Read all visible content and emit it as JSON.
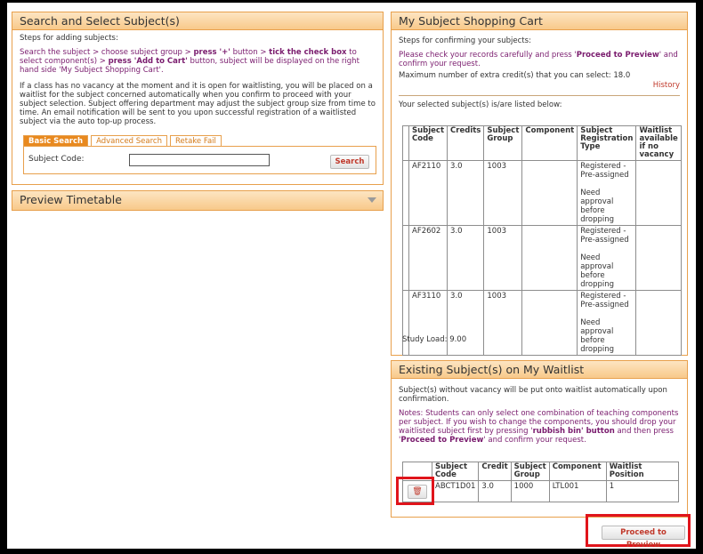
{
  "left_panel": {
    "title": "Search and Select Subject(s)",
    "steps_label": "Steps for adding subjects:",
    "steps_parts": [
      "Search the subject > choose subject group > ",
      "press '+'",
      " button > ",
      "tick the check box",
      " to select component(s) > ",
      "press 'Add to Cart'",
      " button, subject will be displayed on the right hand side 'My Subject Shopping Cart'."
    ],
    "waitlist_note": "If a class has no vacancy at the moment and it is open for waitlisting, you will be placed on a waitlist for the subject concerned automatically when you confirm to proceed with your subject selection. Subject offering department may adjust the subject group size from time to time. An email notification will be sent to you upon successful registration of a waitlisted subject via the auto top-up process.",
    "tabs": [
      "Basic Search",
      "Advanced Search",
      "Retake Fail"
    ],
    "subject_code_label": "Subject Code:",
    "subject_code_value": "",
    "search_button": "Search"
  },
  "preview_panel": {
    "title": "Preview Timetable"
  },
  "cart": {
    "title": "My Subject Shopping Cart",
    "steps_label": "Steps for confirming your subjects:",
    "instruction_parts": [
      "Please check your records carefully and press '",
      "Proceed to Preview",
      "' and confirm your request."
    ],
    "max_credit": "Maximum number of extra credit(s) that you can select: 18.0",
    "history_link": "History",
    "selected_label": "Your selected subject(s) is/are listed below:",
    "columns": [
      "Subject Code",
      "Credits",
      "Subject Group",
      "Component",
      "Subject Registration Type",
      "Waitlist available if no vacancy"
    ],
    "rows": [
      {
        "code": "AF2110",
        "credits": "3.0",
        "group": "1003",
        "component": "",
        "reg_type": "Registered - Pre-assigned",
        "approval": "Need approval before dropping",
        "waitlist": ""
      },
      {
        "code": "AF2602",
        "credits": "3.0",
        "group": "1003",
        "component": "",
        "reg_type": "Registered - Pre-assigned",
        "approval": "Need approval before dropping",
        "waitlist": ""
      },
      {
        "code": "AF3110",
        "credits": "3.0",
        "group": "1003",
        "component": "",
        "reg_type": "Registered - Pre-assigned",
        "approval": "Need approval before dropping",
        "waitlist": ""
      }
    ],
    "study_load": "Study Load: 9.00"
  },
  "waitlist": {
    "title": "Existing Subject(s) on My Waitlist",
    "intro": "Subject(s) without vacancy will be put onto waitlist automatically upon confirmation.",
    "notes_parts": [
      "Notes: Students can only select one combination of teaching components per subject. If you wish to change the components, you should drop your waitlisted subject first by pressing '",
      "rubbish bin' button",
      " and then press '",
      "Proceed to Preview",
      "' and confirm your request."
    ],
    "columns": [
      "Subject Code",
      "Credit",
      "Subject Group",
      "Component",
      "Waitlist Position"
    ],
    "rows": [
      {
        "code": "ABCT1D01",
        "credit": "3.0",
        "group": "1000",
        "component": "LTL001",
        "position": "1"
      }
    ]
  },
  "proceed_button": "Proceed to Preview",
  "icons": {
    "bin": "trash-icon",
    "collapse": "chevron-down-icon"
  },
  "colors": {
    "accent": "#e8891f",
    "link": "#7a1c6e",
    "button_text": "#c0392b",
    "highlight": "#e0141b"
  }
}
